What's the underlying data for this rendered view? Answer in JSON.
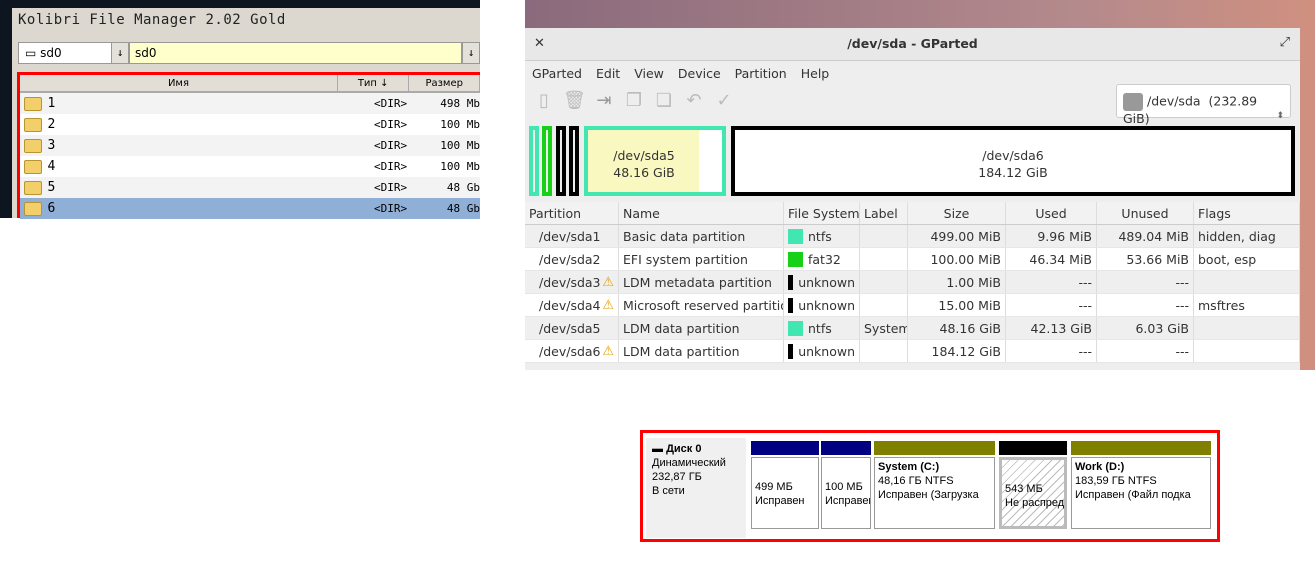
{
  "kolibri": {
    "title": "Kolibri File Manager 2.02 Gold",
    "drive": "sd0",
    "path": "sd0",
    "arrow": "↓",
    "columns": [
      "Имя",
      "Тип ↓",
      "Размер"
    ],
    "rows": [
      {
        "name": "1",
        "type": "<DIR>",
        "size": "498 Mb"
      },
      {
        "name": "2",
        "type": "<DIR>",
        "size": "100 Mb"
      },
      {
        "name": "3",
        "type": "<DIR>",
        "size": "100 Mb"
      },
      {
        "name": "4",
        "type": "<DIR>",
        "size": "100 Mb"
      },
      {
        "name": "5",
        "type": "<DIR>",
        "size": "48 Gb"
      },
      {
        "name": "6",
        "type": "<DIR>",
        "size": "48 Gb",
        "selected": true
      }
    ]
  },
  "gparted": {
    "title": "/dev/sda - GParted",
    "menu": [
      "GParted",
      "Edit",
      "View",
      "Device",
      "Partition",
      "Help"
    ],
    "device": "/dev/sda",
    "device_size": "(232.89 GiB)",
    "map": [
      {
        "name": "/dev/sda5",
        "size": "48.16 GiB"
      },
      {
        "name": "/dev/sda6",
        "size": "184.12 GiB"
      }
    ],
    "columns": [
      "Partition",
      "Name",
      "File System",
      "Label",
      "Size",
      "Used",
      "Unused",
      "Flags"
    ],
    "rows": [
      {
        "partition": "/dev/sda1",
        "warn": false,
        "name": "Basic data partition",
        "fs": "ntfs",
        "fs_color": "#42e6b0",
        "label": "",
        "size": "499.00 MiB",
        "used": "9.96 MiB",
        "unused": "489.04 MiB",
        "flags": "hidden, diag"
      },
      {
        "partition": "/dev/sda2",
        "warn": false,
        "name": "EFI system partition",
        "fs": "fat32",
        "fs_color": "#18d018",
        "label": "",
        "size": "100.00 MiB",
        "used": "46.34 MiB",
        "unused": "53.66 MiB",
        "flags": "boot, esp"
      },
      {
        "partition": "/dev/sda3",
        "warn": true,
        "name": "LDM metadata partition",
        "fs": "unknown",
        "fs_color": "#000000",
        "label": "",
        "size": "1.00 MiB",
        "used": "---",
        "unused": "---",
        "flags": ""
      },
      {
        "partition": "/dev/sda4",
        "warn": true,
        "name": "Microsoft reserved partition",
        "fs": "unknown",
        "fs_color": "#000000",
        "label": "",
        "size": "15.00 MiB",
        "used": "---",
        "unused": "---",
        "flags": "msftres"
      },
      {
        "partition": "/dev/sda5",
        "warn": false,
        "name": "LDM data partition",
        "fs": "ntfs",
        "fs_color": "#42e6b0",
        "label": "System",
        "size": "48.16 GiB",
        "used": "42.13 GiB",
        "unused": "6.03 GiB",
        "flags": ""
      },
      {
        "partition": "/dev/sda6",
        "warn": true,
        "name": "LDM data partition",
        "fs": "unknown",
        "fs_color": "#000000",
        "label": "",
        "size": "184.12 GiB",
        "used": "---",
        "unused": "---",
        "flags": ""
      }
    ]
  },
  "diskmgmt": {
    "disk": "Диск 0",
    "type": "Динамический",
    "size": "232,87 ГБ",
    "status": "В сети",
    "parts": [
      {
        "title": "",
        "l1": "499 МБ",
        "l2": "Исправен",
        "color": "#000080"
      },
      {
        "title": "",
        "l1": "100 МБ",
        "l2": "Исправен",
        "color": "#000080"
      },
      {
        "title": "System  (C:)",
        "l1": "48,16 ГБ NTFS",
        "l2": "Исправен (Загрузка",
        "color": "#808000"
      },
      {
        "title": "",
        "l1": "543 МБ",
        "l2": "Не распределена",
        "color": "#000000"
      },
      {
        "title": "Work  (D:)",
        "l1": "183,59 ГБ NTFS",
        "l2": "Исправен (Файл подка",
        "color": "#808000"
      }
    ]
  }
}
